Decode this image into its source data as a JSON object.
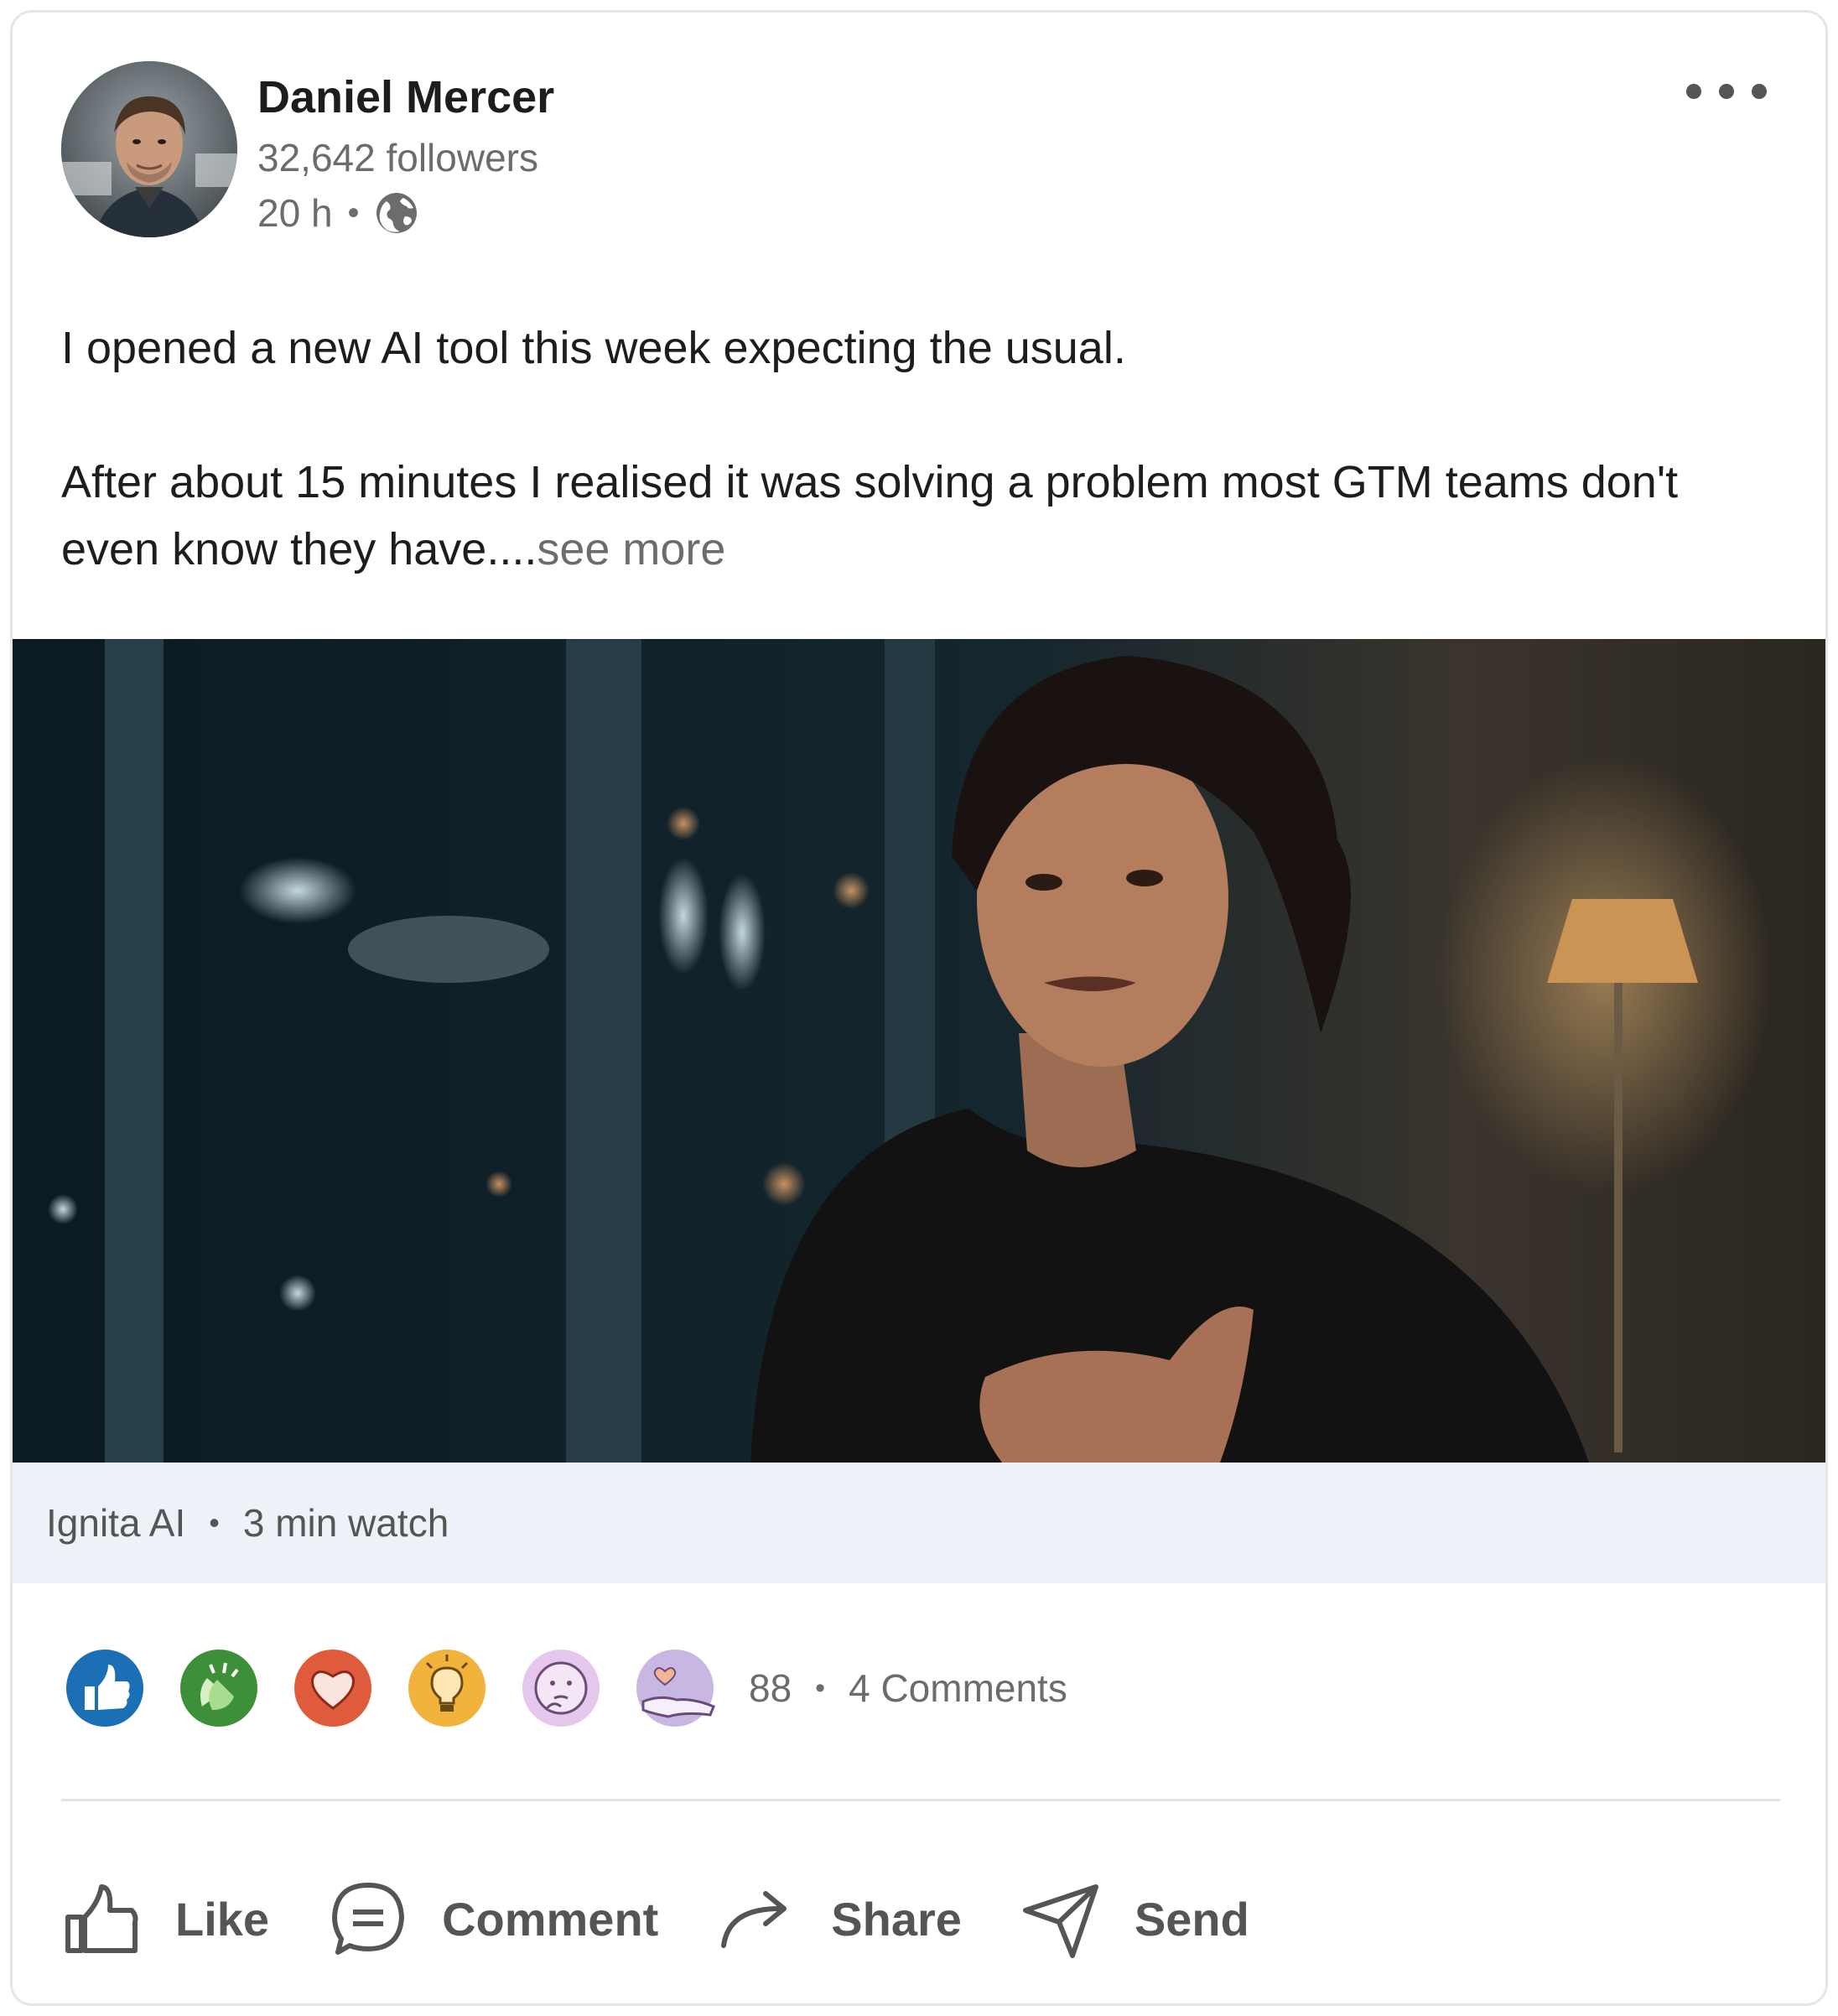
{
  "author": {
    "name": "Daniel Mercer",
    "followers": "32,642 followers",
    "time": "20 h",
    "separator": "•",
    "visibility_icon": "globe-icon"
  },
  "post": {
    "paragraph1": "I opened a new AI tool this week expecting the usual.",
    "paragraph2": "After about 15 minutes I realised it was solving a problem most GTM teams don't even know they have....",
    "see_more": "see more"
  },
  "media": {
    "source": "Ignita AI",
    "separator": "•",
    "duration": "3 min watch"
  },
  "social": {
    "reactions": [
      "like-icon",
      "celebrate-icon",
      "love-icon",
      "insightful-icon",
      "curious-icon",
      "support-icon"
    ],
    "reaction_count": "88",
    "separator": "•",
    "comments": "4 Comments"
  },
  "actions": {
    "like": "Like",
    "comment": "Comment",
    "share": "Share",
    "send": "Send"
  },
  "colors": {
    "like": "#1a6fb5",
    "celebrate": "#3d8f3a",
    "love": "#df5b3c",
    "insightful": "#f2b33d",
    "curious": "#e4c7ea",
    "support": "#c9b7e3",
    "media_footer": "#edf2f8"
  }
}
